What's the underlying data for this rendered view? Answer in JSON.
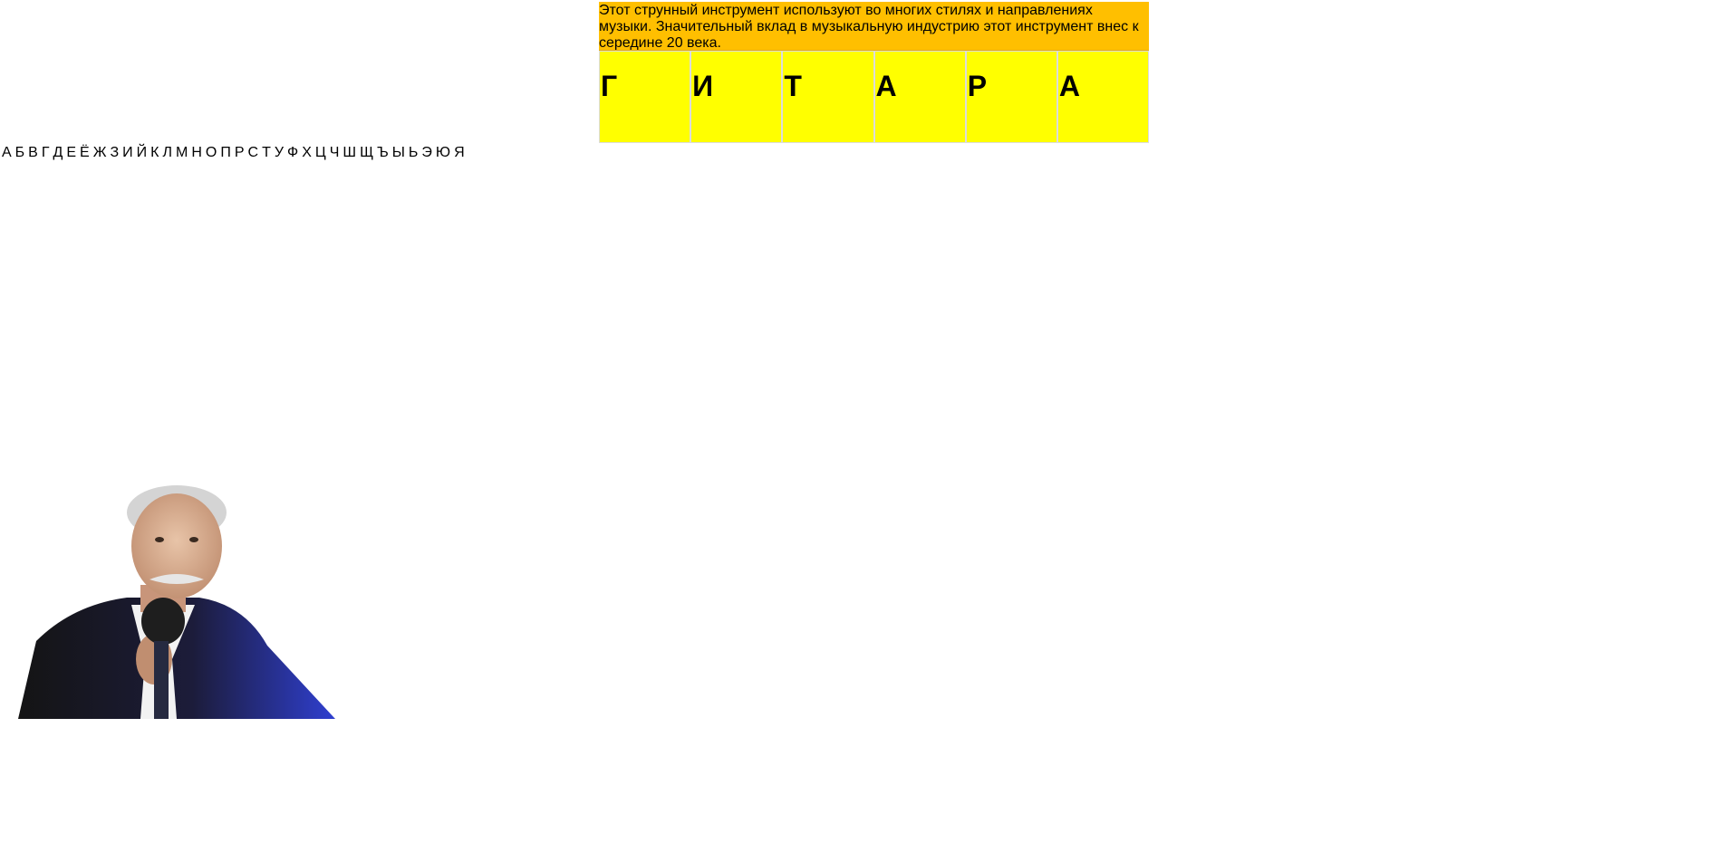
{
  "clue": {
    "text": "Этот струнный инструмент используют во многих стилях и направлениях музыки. Значительный вклад в музыкальную индустрию этот инструмент внес к середине 20 века."
  },
  "word": {
    "letters": [
      "Г",
      "И",
      "Т",
      "А",
      "Р",
      "А"
    ]
  },
  "alphabet": {
    "letters": [
      "А",
      "Б",
      "В",
      "Г",
      "Д",
      "Е",
      "Ё",
      "Ж",
      "З",
      "И",
      "Й",
      "К",
      "Л",
      "М",
      "Н",
      "О",
      "П",
      "Р",
      "С",
      "Т",
      "У",
      "Ф",
      "Х",
      "Ц",
      "Ч",
      "Ш",
      "Щ",
      "Ъ",
      "Ы",
      "Ь",
      "Э",
      "Ю",
      "Я"
    ]
  },
  "colors": {
    "clue_background": "#ffbf00",
    "letter_cell_background": "#ffff00"
  },
  "icons": {
    "host": "host-photo-icon"
  }
}
